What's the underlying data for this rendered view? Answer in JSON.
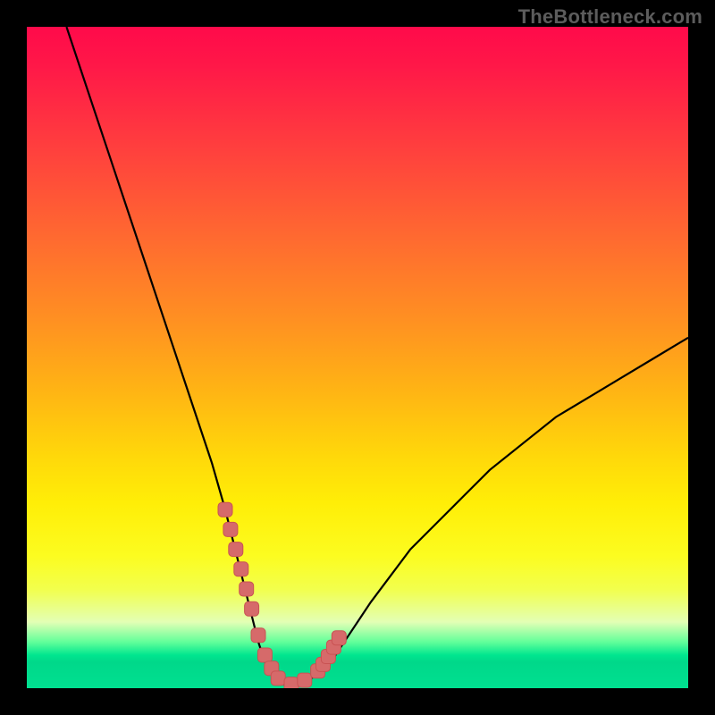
{
  "watermark": {
    "text": "TheBottleneck.com"
  },
  "colors": {
    "curve": "#000000",
    "marker_fill": "#d66a6a",
    "marker_stroke": "#c95353"
  },
  "chart_data": {
    "type": "line",
    "title": "",
    "xlabel": "",
    "ylabel": "",
    "xlim": [
      0,
      100
    ],
    "ylim": [
      0,
      100
    ],
    "grid": false,
    "legend": false,
    "series": [
      {
        "name": "bottleneck-curve",
        "x": [
          6,
          8,
          10,
          12,
          14,
          16,
          18,
          20,
          22,
          24,
          26,
          28,
          30,
          31,
          32,
          33,
          34,
          35,
          36,
          37,
          38,
          39,
          40,
          42,
          44,
          46,
          48,
          50,
          52,
          55,
          58,
          62,
          66,
          70,
          75,
          80,
          85,
          90,
          95,
          100
        ],
        "y": [
          100,
          94,
          88,
          82,
          76,
          70,
          64,
          58,
          52,
          46,
          40,
          34,
          27,
          23,
          19,
          15,
          11,
          7,
          4,
          2,
          1,
          0.5,
          0.5,
          1,
          2,
          4,
          7,
          10,
          13,
          17,
          21,
          25,
          29,
          33,
          37,
          41,
          44,
          47,
          50,
          53
        ]
      }
    ],
    "markers": {
      "name": "highlight-points",
      "x": [
        30,
        30.8,
        31.6,
        32.4,
        33.2,
        34,
        35,
        36,
        37,
        38,
        40,
        42,
        44,
        44.8,
        45.6,
        46.4,
        47.2
      ],
      "y": [
        27,
        24,
        21,
        18,
        15,
        12,
        8,
        5,
        3,
        1.5,
        0.6,
        1.2,
        2.6,
        3.6,
        4.8,
        6.2,
        7.6
      ]
    }
  }
}
